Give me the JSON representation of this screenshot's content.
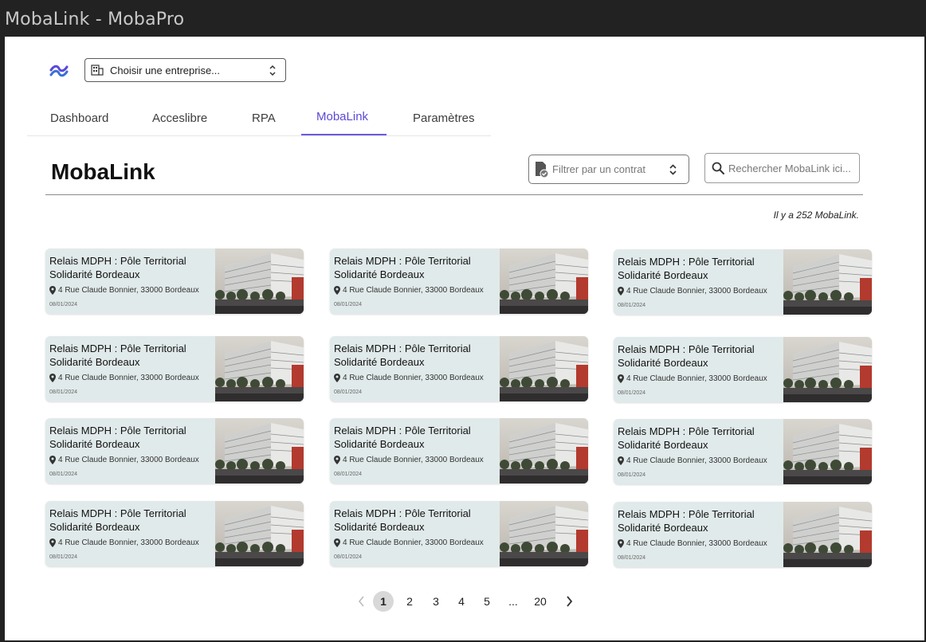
{
  "window": {
    "title": "MobaLink - MobaPro"
  },
  "header": {
    "logo_icon": "tailwind-wave-icon",
    "company_select": {
      "label": "Choisir une entreprise...",
      "icon": "building-icon"
    }
  },
  "nav": {
    "tabs": [
      {
        "label": "Dashboard",
        "active": false
      },
      {
        "label": "Acceslibre",
        "active": false
      },
      {
        "label": "RPA",
        "active": false
      },
      {
        "label": "MobaLink",
        "active": true
      },
      {
        "label": "Paramètres",
        "active": false
      }
    ],
    "accent": "#5a49d8"
  },
  "main": {
    "title": "MobaLink",
    "filter": {
      "placeholder": "Filtrer par un contrat",
      "icon": "document-check-icon"
    },
    "search": {
      "placeholder": "Rechercher MobaLink ici..."
    },
    "count_text": "Il y a 252 MobaLink."
  },
  "cards": [
    {
      "title": "Relais MDPH : Pôle Territorial Solidarité Bordeaux",
      "address": "4 Rue Claude Bonnier, 33000 Bordeaux",
      "date": "08/01/2024"
    },
    {
      "title": "Relais MDPH : Pôle Territorial Solidarité Bordeaux",
      "address": "4 Rue Claude Bonnier, 33000 Bordeaux",
      "date": "08/01/2024"
    },
    {
      "title": "Relais MDPH : Pôle Territorial Solidarité Bordeaux",
      "address": "4 Rue Claude Bonnier, 33000 Bordeaux",
      "date": "08/01/2024"
    },
    {
      "title": "Relais MDPH : Pôle Territorial Solidarité Bordeaux",
      "address": "4 Rue Claude Bonnier, 33000 Bordeaux",
      "date": "08/01/2024"
    },
    {
      "title": "Relais MDPH : Pôle Territorial Solidarité Bordeaux",
      "address": "4 Rue Claude Bonnier, 33000 Bordeaux",
      "date": "08/01/2024"
    },
    {
      "title": "Relais MDPH : Pôle Territorial Solidarité Bordeaux",
      "address": "4 Rue Claude Bonnier, 33000 Bordeaux",
      "date": "08/01/2024"
    },
    {
      "title": "Relais MDPH : Pôle Territorial Solidarité Bordeaux",
      "address": "4 Rue Claude Bonnier, 33000 Bordeaux",
      "date": "08/01/2024"
    },
    {
      "title": "Relais MDPH : Pôle Territorial Solidarité Bordeaux",
      "address": "4 Rue Claude Bonnier, 33000 Bordeaux",
      "date": "08/01/2024"
    },
    {
      "title": "Relais MDPH : Pôle Territorial Solidarité Bordeaux",
      "address": "4 Rue Claude Bonnier, 33000 Bordeaux",
      "date": "08/01/2024"
    },
    {
      "title": "Relais MDPH : Pôle Territorial Solidarité Bordeaux",
      "address": "4 Rue Claude Bonnier, 33000 Bordeaux",
      "date": "08/01/2024"
    },
    {
      "title": "Relais MDPH : Pôle Territorial Solidarité Bordeaux",
      "address": "4 Rue Claude Bonnier, 33000 Bordeaux",
      "date": "08/01/2024"
    },
    {
      "title": "Relais MDPH : Pôle Territorial Solidarité Bordeaux",
      "address": "4 Rue Claude Bonnier, 33000 Bordeaux",
      "date": "08/01/2024"
    }
  ],
  "pagination": {
    "prev_icon": "chevron-left-icon",
    "pages": [
      "1",
      "2",
      "3",
      "4",
      "5",
      "...",
      "20"
    ],
    "current": "1",
    "next_icon": "chevron-right-icon"
  }
}
